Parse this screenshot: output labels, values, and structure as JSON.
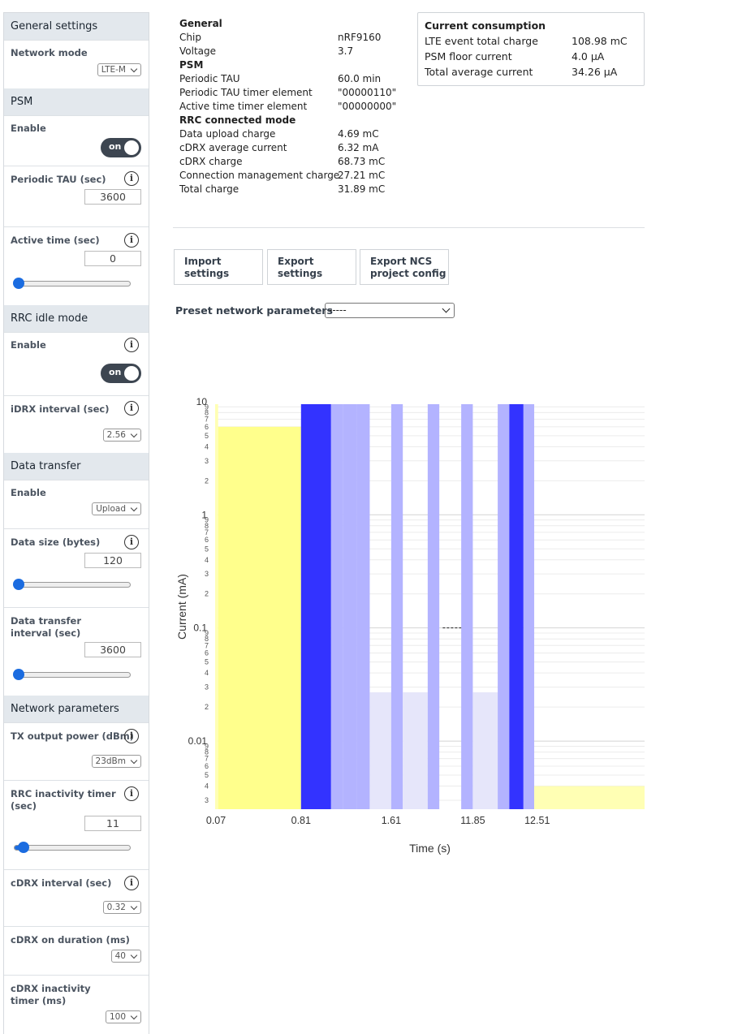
{
  "sidebar": {
    "general": {
      "title": "General settings",
      "network_mode": {
        "label": "Network mode",
        "value": "LTE-M"
      }
    },
    "psm": {
      "title": "PSM",
      "enable": {
        "label": "Enable",
        "toggle": "on"
      },
      "periodic_tau": {
        "label": "Periodic TAU (sec)",
        "value": "3600"
      },
      "active_time": {
        "label": "Active time (sec)",
        "value": "0",
        "slider_fraction": 0.0
      }
    },
    "rrc_idle": {
      "title": "RRC idle mode",
      "enable": {
        "label": "Enable",
        "toggle": "on"
      },
      "idrx_interval": {
        "label": "iDRX interval (sec)",
        "value": "2.56"
      }
    },
    "data_transfer": {
      "title": "Data transfer",
      "enable": {
        "label": "Enable",
        "value": "Upload"
      },
      "data_size": {
        "label": "Data size (bytes)",
        "value": "120",
        "slider_fraction": 0.0
      },
      "interval": {
        "label": "Data transfer interval (sec)",
        "value": "3600",
        "slider_fraction": 0.0
      }
    },
    "network": {
      "title": "Network parameters",
      "tx_power": {
        "label": "TX output power (dBm)",
        "value": "23dBm"
      },
      "rrc_inactivity": {
        "label": "RRC inactivity timer (sec)",
        "value": "11",
        "slider_fraction": 0.08
      },
      "cdrx_interval": {
        "label": "cDRX interval (sec)",
        "value": "0.32"
      },
      "cdrx_on": {
        "label": "cDRX on duration (ms)",
        "value": "40"
      },
      "cdrx_inactivity": {
        "label": "cDRX inactivity timer (ms)",
        "value": "100"
      }
    }
  },
  "summary": {
    "rows": [
      {
        "label": "General",
        "value": "",
        "bold": true
      },
      {
        "label": "Chip",
        "value": "nRF9160"
      },
      {
        "label": "Voltage",
        "value": "3.7"
      },
      {
        "label": "PSM",
        "value": "",
        "bold": true
      },
      {
        "label": "Periodic TAU",
        "value": "60.0 min"
      },
      {
        "label": "Periodic TAU timer element",
        "value": "\"00000110\""
      },
      {
        "label": "Active time timer element",
        "value": "\"00000000\""
      },
      {
        "label": "RRC connected mode",
        "value": "",
        "bold": true
      },
      {
        "label": "Data upload charge",
        "value": "4.69 mC"
      },
      {
        "label": "cDRX average current",
        "value": "6.32 mA"
      },
      {
        "label": "cDRX charge",
        "value": "68.73 mC"
      },
      {
        "label": "Connection management charge",
        "value": "27.21 mC"
      },
      {
        "label": "Total charge",
        "value": "31.89 mC"
      }
    ]
  },
  "consumption": {
    "title": "Current consumption",
    "rows": [
      {
        "label": "LTE event total charge",
        "value": "108.98 mC"
      },
      {
        "label": "PSM floor current",
        "value": "4.0 µA"
      },
      {
        "label": "Total average current",
        "value": "34.26 µA"
      }
    ]
  },
  "buttons": {
    "import": [
      "Import",
      "settings"
    ],
    "export": [
      "Export",
      "settings"
    ],
    "export_ncs": [
      "Export NCS",
      "project config"
    ]
  },
  "preset": {
    "label": "Preset network parameters",
    "value": "-----"
  },
  "chart_data": {
    "type": "bar",
    "xlabel": "Time (s)",
    "ylabel": "Current (mA)",
    "y_scale": "log",
    "ylim": [
      0.0025,
      9.5
    ],
    "y_major_ticks": [
      {
        "value": 0.01,
        "label": "0.01"
      },
      {
        "value": 0.1,
        "label": "0.1"
      },
      {
        "value": 1,
        "label": "1"
      },
      {
        "value": 10,
        "label": "10"
      }
    ],
    "y_minor_labels": [
      "2",
      "3",
      "4",
      "5",
      "6",
      "7",
      "8",
      "9"
    ],
    "x_tick_labels": [
      "0.07",
      "0.81",
      "1.61",
      "11.85",
      "12.51"
    ],
    "colors": {
      "yellow": "#ffff8c",
      "yellow_light": "#ffffb4",
      "blue": "#3333ff",
      "blue_light": "#b3b3ff",
      "blue_faint": "#e6e6fa"
    },
    "segments": [
      {
        "x0": 0,
        "x1": 0.7,
        "value": 17,
        "color": "yellow_light"
      },
      {
        "x0": 0.7,
        "x1": 20,
        "value": 6,
        "color": "yellow"
      },
      {
        "x0": 20,
        "x1": 27,
        "value": 50,
        "color": "blue"
      },
      {
        "x0": 27,
        "x1": 29.7,
        "value": 50,
        "color": "blue_light"
      },
      {
        "x0": 29.7,
        "x1": 33,
        "value": 38,
        "color": "blue_light"
      },
      {
        "x0": 33,
        "x1": 36,
        "value": 42,
        "color": "blue_light"
      },
      {
        "x0": 36,
        "x1": 41,
        "value": 0.027,
        "color": "blue_faint"
      },
      {
        "x0": 41,
        "x1": 43.7,
        "value": 18,
        "color": "blue_light"
      },
      {
        "x0": 43.7,
        "x1": 49.5,
        "value": 0.027,
        "color": "blue_faint"
      },
      {
        "x0": 49.5,
        "x1": 52.2,
        "value": 18,
        "color": "blue_light"
      },
      {
        "x0": 57.3,
        "x1": 60,
        "value": 18,
        "color": "blue_light"
      },
      {
        "x0": 60,
        "x1": 65.8,
        "value": 0.027,
        "color": "blue_faint"
      },
      {
        "x0": 65.8,
        "x1": 68.5,
        "value": 18,
        "color": "blue_light"
      },
      {
        "x0": 68.5,
        "x1": 71.8,
        "value": 23,
        "color": "blue"
      },
      {
        "x0": 71.8,
        "x1": 74.3,
        "value": 42,
        "color": "blue_light"
      },
      {
        "x0": 74.3,
        "x1": 100,
        "value": 0.004,
        "color": "yellow_light"
      }
    ],
    "dashed_level": {
      "x0": 53,
      "x1": 57.3,
      "value": 0.1
    }
  }
}
